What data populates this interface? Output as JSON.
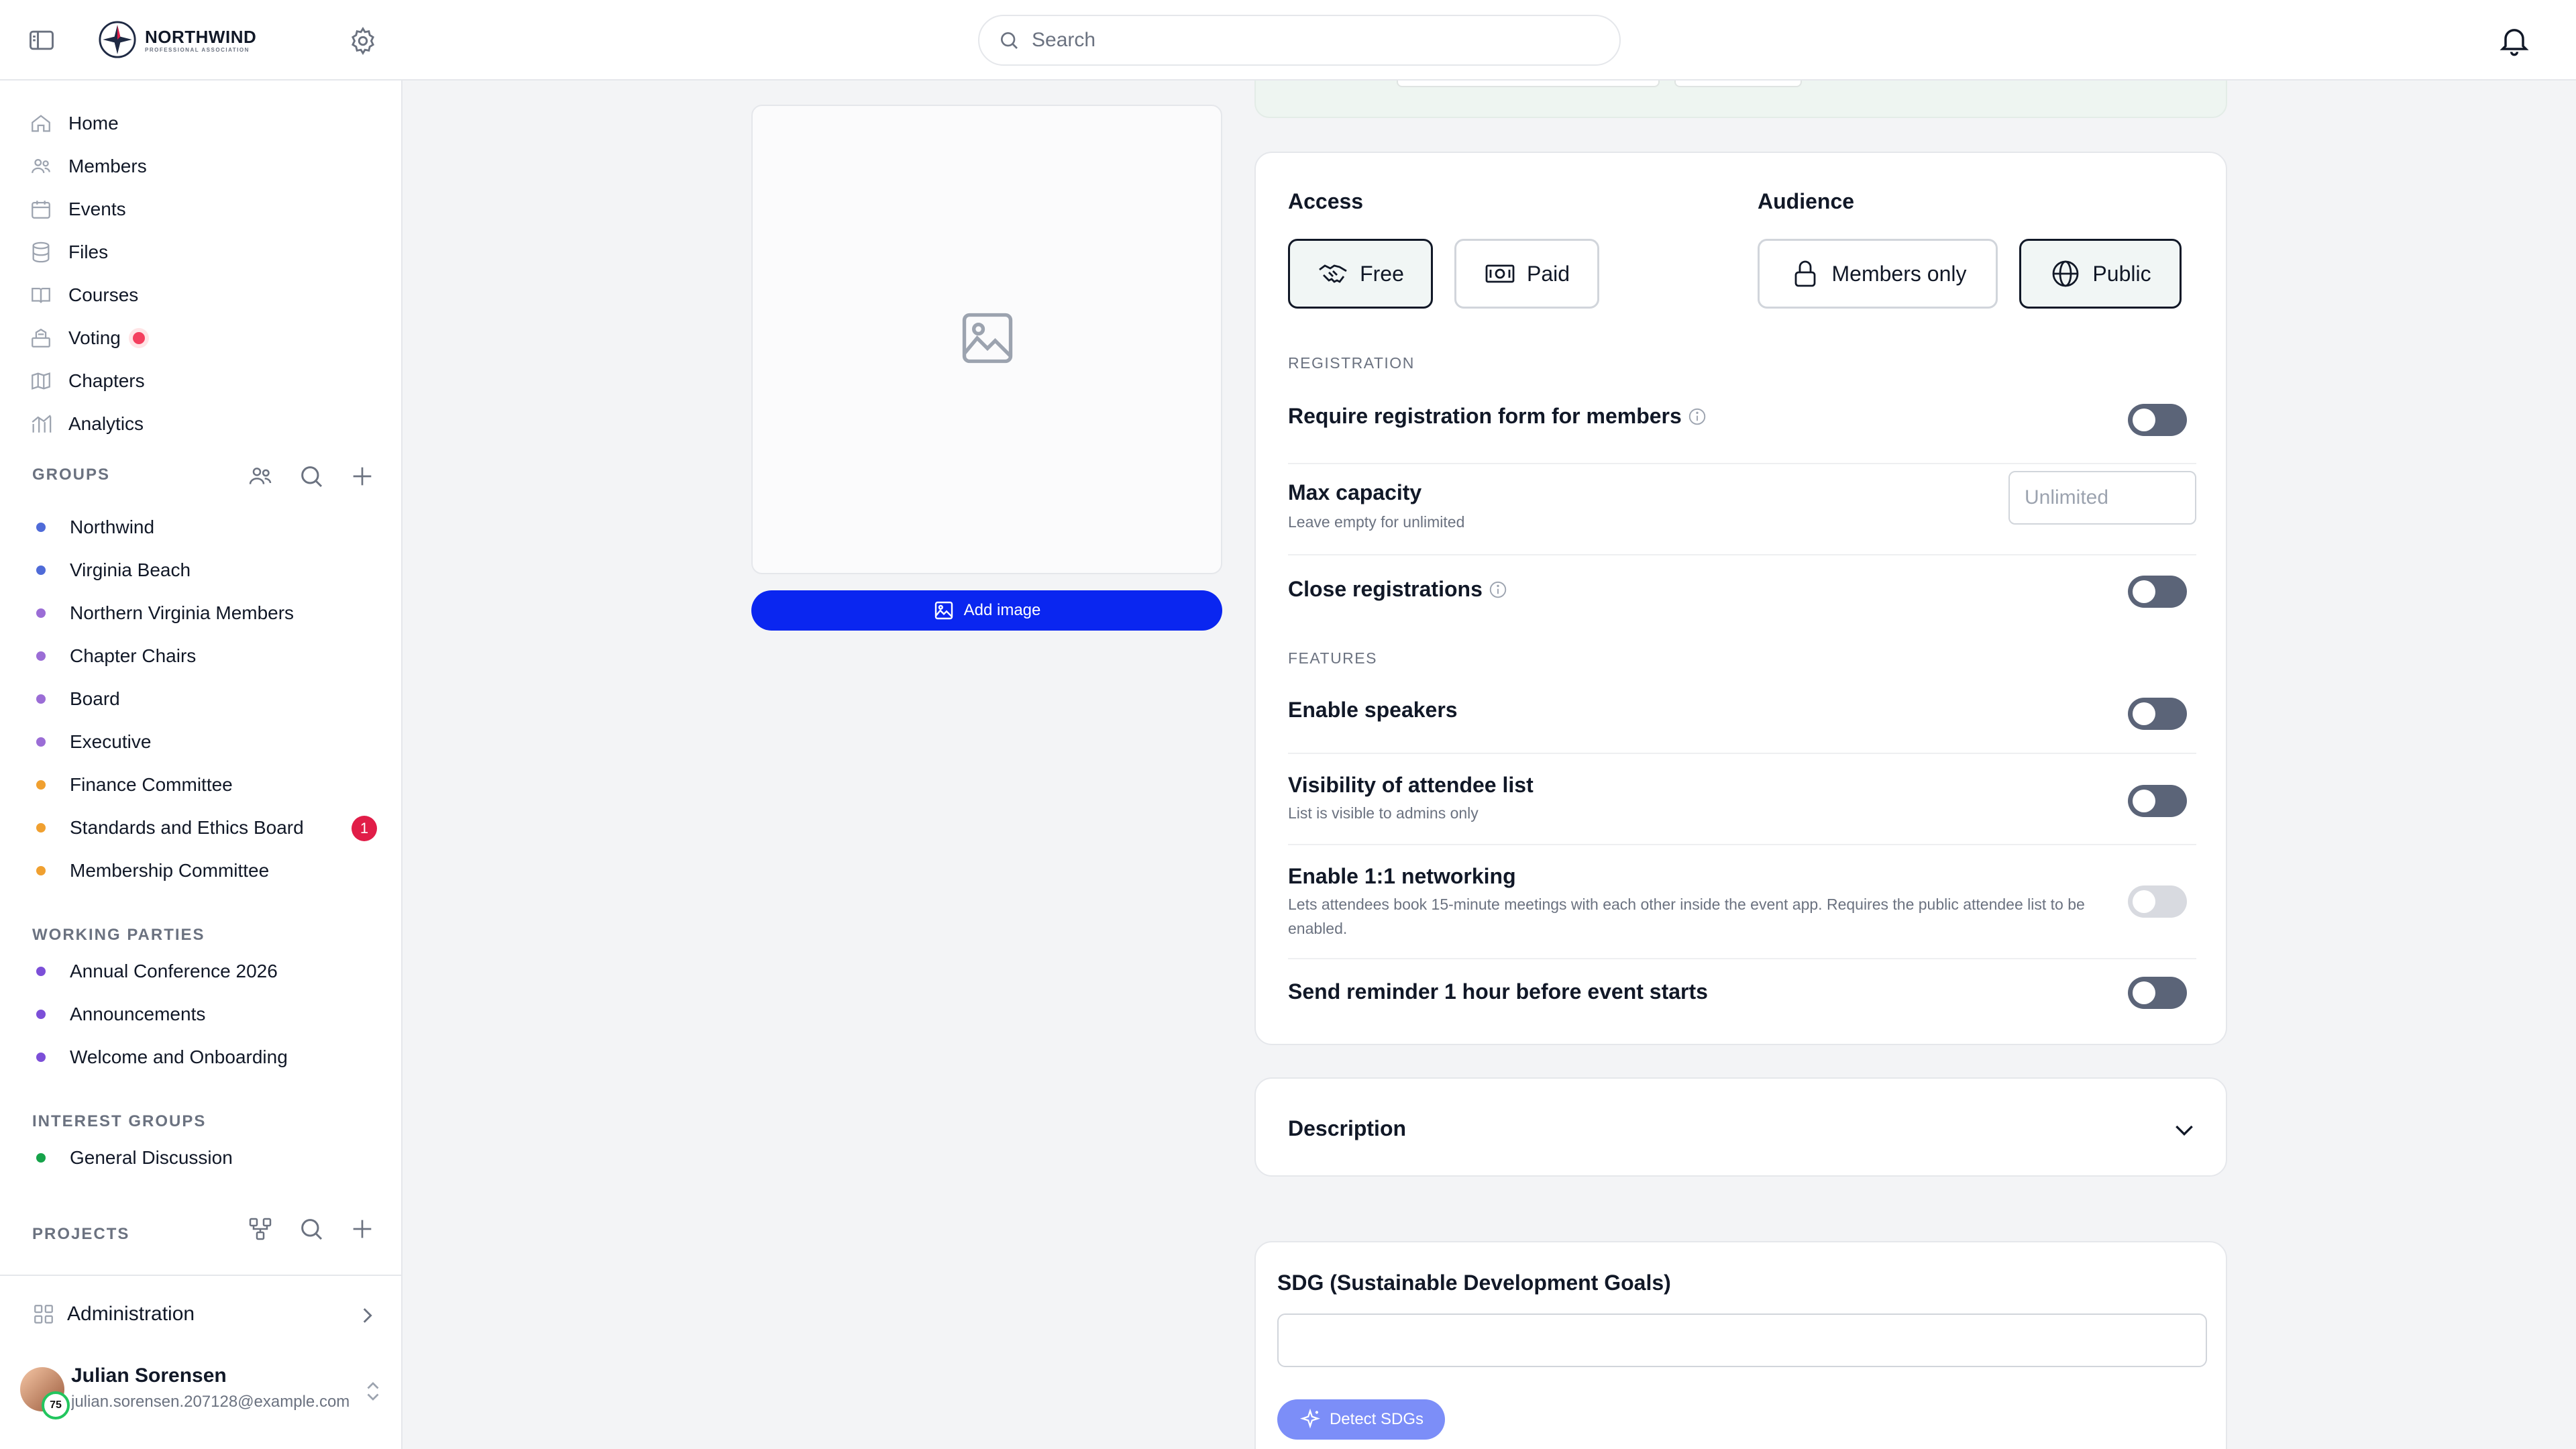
{
  "header": {
    "logo_name": "NORTHWIND",
    "logo_sub": "PROFESSIONAL ASSOCIATION",
    "search_placeholder": "Search"
  },
  "sidebar": {
    "nav": [
      {
        "label": "Home",
        "icon": "home-icon"
      },
      {
        "label": "Members",
        "icon": "members-icon"
      },
      {
        "label": "Events",
        "icon": "calendar-icon"
      },
      {
        "label": "Files",
        "icon": "database-icon"
      },
      {
        "label": "Courses",
        "icon": "book-icon"
      },
      {
        "label": "Voting",
        "icon": "ballot-icon"
      },
      {
        "label": "Chapters",
        "icon": "map-icon"
      },
      {
        "label": "Analytics",
        "icon": "chart-icon"
      }
    ],
    "groups_label": "GROUPS",
    "groups": [
      {
        "label": "Northwind",
        "color": "#4f6bd8"
      },
      {
        "label": "Virginia Beach",
        "color": "#4f6bd8"
      },
      {
        "label": "Northern Virginia Members",
        "color": "#9b6dd6"
      },
      {
        "label": "Chapter Chairs",
        "color": "#9b6dd6"
      },
      {
        "label": "Board",
        "color": "#9b6dd6"
      },
      {
        "label": "Executive",
        "color": "#9b6dd6"
      },
      {
        "label": "Finance Committee",
        "color": "#f0a030"
      },
      {
        "label": "Standards and Ethics Board",
        "color": "#f0a030"
      },
      {
        "label": "Membership Committee",
        "color": "#f0a030"
      }
    ],
    "groups_badge": "1",
    "working_label": "WORKING PARTIES",
    "working": [
      {
        "label": "Annual Conference 2026",
        "color": "#7c4fd8"
      },
      {
        "label": "Announcements",
        "color": "#7c4fd8"
      },
      {
        "label": "Welcome and Onboarding",
        "color": "#7c4fd8"
      }
    ],
    "interest_label": "INTEREST GROUPS",
    "interest": [
      {
        "label": "General Discussion",
        "color": "#16a34a"
      }
    ],
    "projects_label": "PROJECTS",
    "administration": "Administration",
    "user": {
      "name": "Julian Sorensen",
      "email": "julian.sorensen.207128@example.com",
      "level": "75"
    }
  },
  "main": {
    "add_image": "Add image",
    "access_label": "Access",
    "access_options": [
      "Free",
      "Paid"
    ],
    "audience_label": "Audience",
    "audience_options": [
      "Members only",
      "Public"
    ],
    "registration_label": "REGISTRATION",
    "require_form": "Require registration form for members",
    "max_capacity": "Max capacity",
    "max_capacity_desc": "Leave empty for unlimited",
    "max_capacity_placeholder": "Unlimited",
    "close_registrations": "Close registrations",
    "features_label": "FEATURES",
    "enable_speakers": "Enable speakers",
    "attendee_visibility": "Visibility of attendee list",
    "attendee_visibility_desc": "List is visible to admins only",
    "networking": "Enable 1:1 networking",
    "networking_desc": "Lets attendees book 15-minute meetings with each other inside the event app. Requires the public attendee list to be enabled.",
    "reminder": "Send reminder 1 hour before event starts",
    "description_label": "Description",
    "sdg_label": "SDG (Sustainable Development Goals)",
    "detect_sdgs": "Detect SDGs"
  }
}
